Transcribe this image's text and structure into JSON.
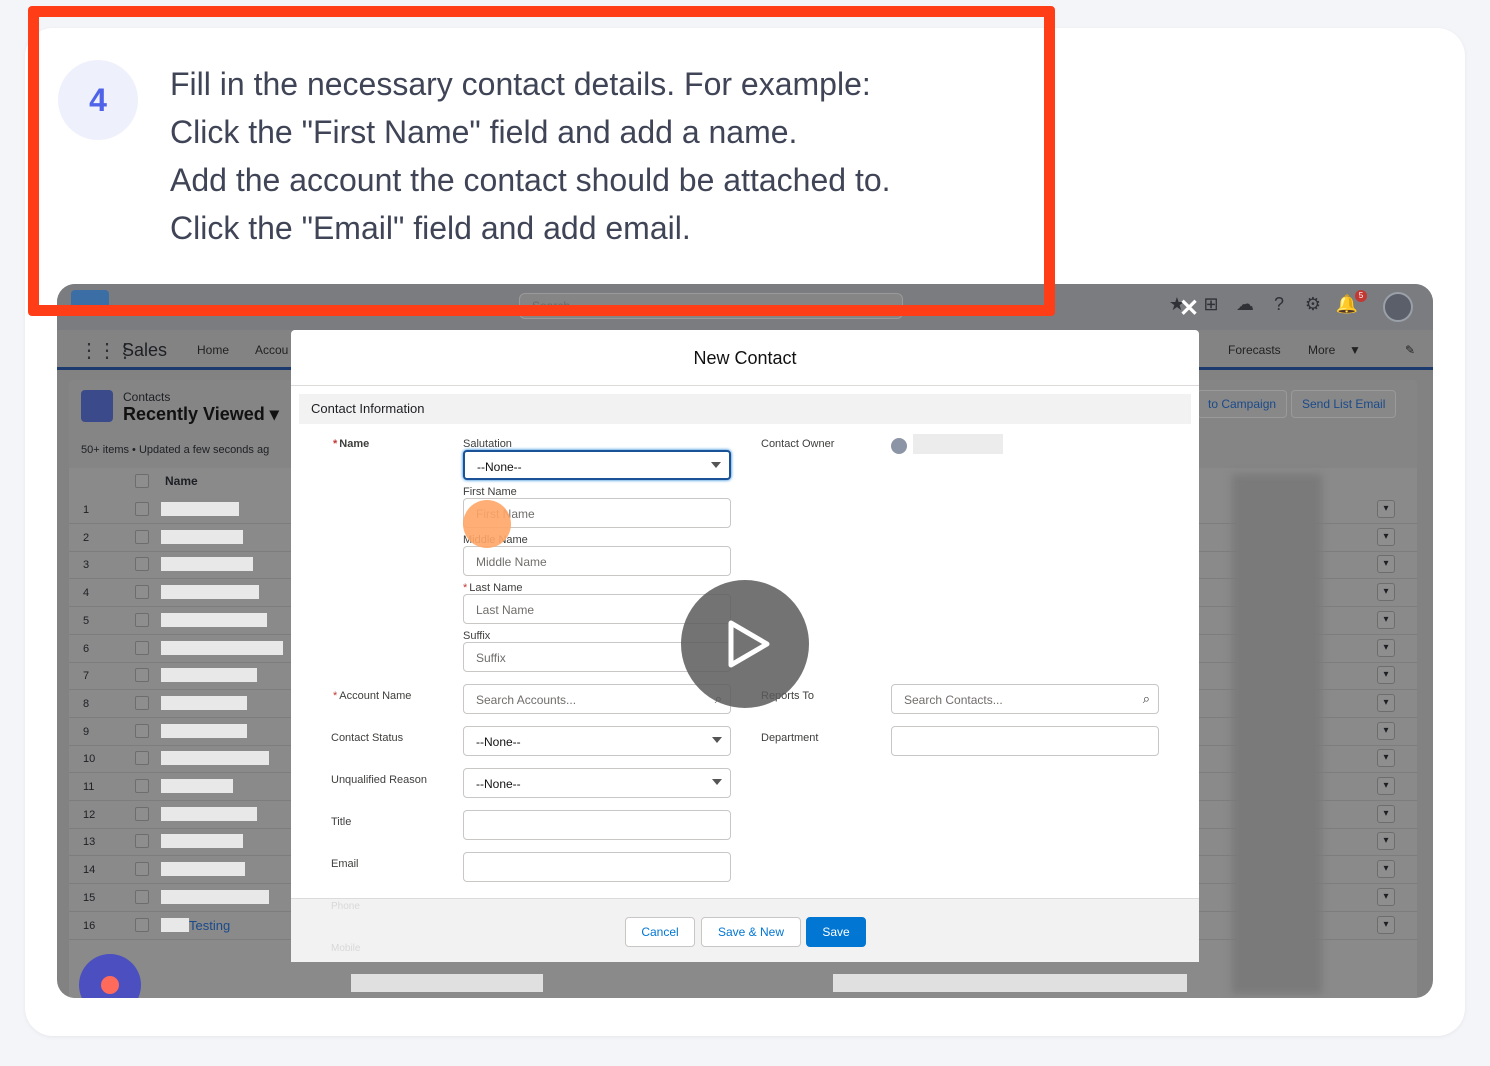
{
  "step": {
    "number": "4",
    "lines": [
      "Fill in the necessary contact details. For example:",
      "Click the \"First Name\" field and add a name.",
      "Add the account the contact should be attached to.",
      "Click the \"Email\" field and add email."
    ]
  },
  "header": {
    "search_placeholder": "Search..."
  },
  "notifications": {
    "count": "5"
  },
  "nav": {
    "app_name": "Sales",
    "items": [
      "Home",
      "Accou",
      "Forecasts",
      "More"
    ]
  },
  "list": {
    "object_label": "Contacts",
    "view_name": "Recently Viewed",
    "meta": "50+ items • Updated a few seconds ag",
    "buttons": [
      "to Campaign",
      "Send List Email"
    ],
    "column_name": "Name",
    "row_numbers": [
      "1",
      "2",
      "3",
      "4",
      "5",
      "6",
      "7",
      "8",
      "9",
      "10",
      "11",
      "12",
      "13",
      "14",
      "15",
      "16"
    ],
    "visible_link_row_16": "Testing"
  },
  "modal": {
    "title": "New Contact",
    "section": "Contact Information",
    "labels": {
      "name": "Name",
      "salutation": "Salutation",
      "first_name": "First Name",
      "middle_name": "Middle Name",
      "last_name": "Last Name",
      "suffix": "Suffix",
      "account_name": "Account Name",
      "contact_status": "Contact Status",
      "unqualified_reason": "Unqualified Reason",
      "title": "Title",
      "email": "Email",
      "contact_owner": "Contact Owner",
      "reports_to": "Reports To",
      "department": "Department",
      "phone_faded": "Phone",
      "mobile_faded": "Mobile"
    },
    "values": {
      "salutation": "--None--",
      "first_name_placeholder": "First Name",
      "middle_name_placeholder": "Middle Name",
      "last_name_placeholder": "Last Name",
      "suffix_placeholder": "Suffix",
      "account_placeholder": "Search Accounts...",
      "contact_status": "--None--",
      "unqualified_reason": "--None--",
      "reports_to_placeholder": "Search Contacts..."
    },
    "buttons": {
      "cancel": "Cancel",
      "save_new": "Save & New",
      "save": "Save"
    }
  },
  "colors": {
    "highlight": "#ff3d17",
    "accent": "#4f63e8",
    "salesforce_blue": "#0176d3"
  }
}
